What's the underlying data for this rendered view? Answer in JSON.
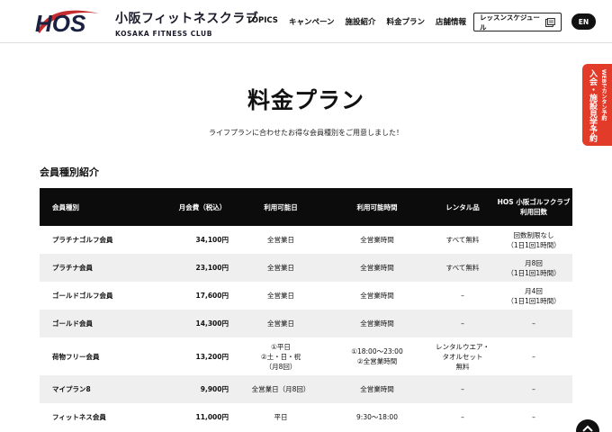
{
  "header": {
    "logo_mark": "HOS",
    "logo_jp": "小阪フィットネスクラブ",
    "logo_en": "KOSAKA FITNESS CLUB",
    "nav": [
      "TOPICS",
      "キャンペーン",
      "施設紹介",
      "料金プラン",
      "店舗情報"
    ],
    "lesson_button": "レッスンスケジュール",
    "lang_button": "EN"
  },
  "side_tab": {
    "small": "WEBでカンタン予約",
    "big": "入会・施設見学予約"
  },
  "main": {
    "title": "料金プラン",
    "subtitle": "ライフプランに合わせたお得な会員種別をご用意しました！",
    "section_title": "会員種別紹介"
  },
  "table": {
    "headers": [
      "会員種別",
      "月会費（税込）",
      "利用可能日",
      "利用可能時間",
      "レンタル品",
      [
        "HOS 小阪ゴルフクラブ",
        "利用回数"
      ]
    ],
    "rows": [
      [
        "プラチナゴルフ会員",
        "34,100円",
        [
          "全営業日"
        ],
        [
          "全営業時間"
        ],
        [
          "すべて無料"
        ],
        [
          "回数制限なし",
          "（1日1回1時間）"
        ]
      ],
      [
        "プラチナ会員",
        "23,100円",
        [
          "全営業日"
        ],
        [
          "全営業時間"
        ],
        [
          "すべて無料"
        ],
        [
          "月8回",
          "（1日1回1時間）"
        ]
      ],
      [
        "ゴールドゴルフ会員",
        "17,600円",
        [
          "全営業日"
        ],
        [
          "全営業時間"
        ],
        [
          "–"
        ],
        [
          "月4回",
          "（1日1回1時間）"
        ]
      ],
      [
        "ゴールド会員",
        "14,300円",
        [
          "全営業日"
        ],
        [
          "全営業時間"
        ],
        [
          "–"
        ],
        [
          "–"
        ]
      ],
      [
        "荷物フリー会員",
        "13,200円",
        [
          "①平日",
          "②土・日・祝",
          "（月8回）"
        ],
        [
          "①18:00～23:00",
          "②全営業時間"
        ],
        [
          "レンタルウエア・",
          "タオルセット",
          "無料"
        ],
        [
          "–"
        ]
      ],
      [
        "マイプラン8",
        "9,900円",
        [
          "全営業日（月8回）"
        ],
        [
          "全営業時間"
        ],
        [
          "–"
        ],
        [
          "–"
        ]
      ],
      [
        "フィットネス会員",
        "11,000円",
        [
          "平日"
        ],
        [
          "9:30～18:00"
        ],
        [
          "–"
        ],
        [
          "–"
        ]
      ]
    ]
  },
  "colors": {
    "accent_red": "#e23b2a",
    "table_header": "#0c0c0c",
    "row_alt": "#efefef"
  },
  "icons": {
    "lesson": "calendar-icon",
    "scroll_top": "arrow-up-icon"
  }
}
